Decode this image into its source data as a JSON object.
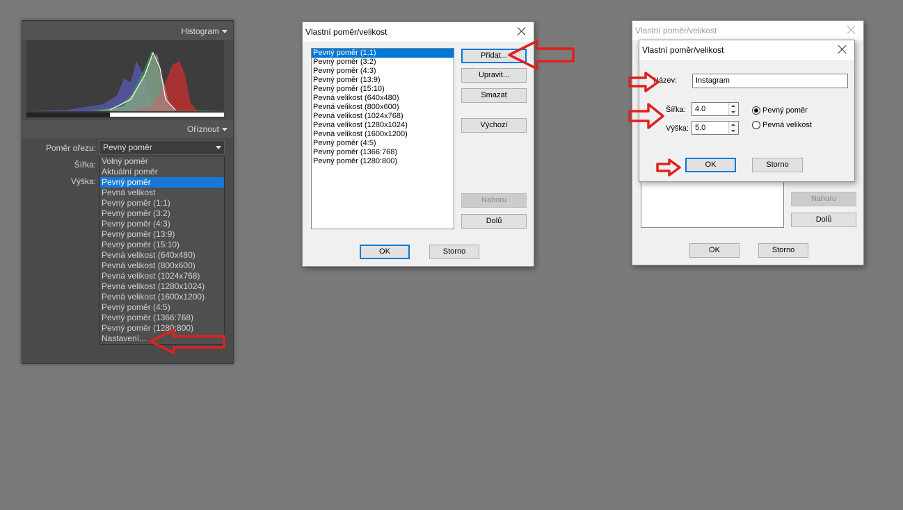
{
  "lr_panel": {
    "histogram_label": "Histogram",
    "crop_label": "Oříznout",
    "ratio_label": "Poměr ořezu:",
    "width_label": "Šířka:",
    "height_label": "Výška:",
    "ratio_selected": "Pevný poměr",
    "ratio_options": [
      "Volný poměr",
      "Aktuální poměr",
      "Pevný poměr",
      "Pevná velikost",
      "Pevný poměr (1:1)",
      "Pevný poměr (3:2)",
      "Pevný poměr (4:3)",
      "Pevný poměr (13:9)",
      "Pevný poměr (15:10)",
      "Pevná velikost (640x480)",
      "Pevná velikost (800x600)",
      "Pevná velikost (1024x768)",
      "Pevná velikost (1280x1024)",
      "Pevná velikost (1600x1200)",
      "Pevný poměr (4:5)",
      "Pevný poměr (1366:768)",
      "Pevný poměr (1280:800)",
      "Nastavení..."
    ],
    "selected_index": 2
  },
  "dialog1": {
    "title": "Vlastní poměr/velikost",
    "items": [
      "Pevný poměr (1:1)",
      "Pevný poměr (3:2)",
      "Pevný poměr (4:3)",
      "Pevný poměr (13:9)",
      "Pevný poměr (15:10)",
      "Pevná velikost (640x480)",
      "Pevná velikost (800x600)",
      "Pevná velikost (1024x768)",
      "Pevná velikost (1280x1024)",
      "Pevná velikost (1600x1200)",
      "Pevný poměr (4:5)",
      "Pevný poměr (1366:768)",
      "Pevný poměr (1280:800)"
    ],
    "selected_index": 0,
    "btn_add": "Přidat...",
    "btn_edit": "Upravit...",
    "btn_delete": "Smazat",
    "btn_default": "Výchozí",
    "btn_up": "Nahoru",
    "btn_down": "Dolů",
    "btn_ok": "OK",
    "btn_cancel": "Storno"
  },
  "dialog2_back": {
    "title": "Vlastní poměr/velikost",
    "btn_up": "Nahoru",
    "btn_down": "Dolů",
    "btn_ok": "OK",
    "btn_cancel": "Storno"
  },
  "dialog2_front": {
    "title": "Vlastní poměr/velikost",
    "name_label": "Název:",
    "name_value": "Instagram",
    "width_label": "Šířka:",
    "width_value": "4.0",
    "height_label": "Výška:",
    "height_value": "5.0",
    "radio_fixed_ratio": "Pevný poměr",
    "radio_fixed_size": "Pevná velikost",
    "btn_ok": "OK",
    "btn_cancel": "Storno"
  },
  "colors": {
    "annotation_arrow": "#e02020",
    "selection_blue": "#0078d7"
  }
}
